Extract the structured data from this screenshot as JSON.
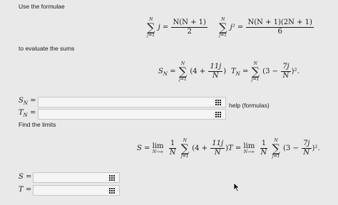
{
  "intro": "Use the formulae",
  "formula1_lhs": "j",
  "formula1_rhs_num": "N(N + 1)",
  "formula1_rhs_den": "2",
  "formula2_lhs": "j²",
  "formula2_rhs_num": "N(N + 1)(2N + 1)",
  "formula2_rhs_den": "6",
  "sum_upper": "N",
  "sum_lower": "j=1",
  "evaluate_text": "to evaluate the sums",
  "SN_def_lhs": "S",
  "SN_def_sub": "N",
  "SN_term_a": "(4 +",
  "SN_frac_num": "11j",
  "SN_frac_den": "N",
  "SN_close": ")",
  "TN_def_lhs": "T",
  "TN_def_sub": "N",
  "TN_term_a": "(3 −",
  "TN_frac_num": "7j",
  "TN_frac_den": "N",
  "TN_close": ")².",
  "answer_SN_label": "S",
  "answer_SN_sub": "N",
  "answer_TN_label": "T",
  "answer_TN_sub": "N",
  "equals": "=",
  "help_link": "help (formulas)",
  "find_limits": "Find the limits",
  "limit_S_lhs": "S =",
  "limit_T_lhs": "T =",
  "lim": "lim",
  "lim_sub": "N→∞",
  "one": "1",
  "N": "N",
  "limit_S_tail": ")",
  "limit_T_tail": ")².",
  "answer_S_label": "S =",
  "answer_T_label": "T ="
}
